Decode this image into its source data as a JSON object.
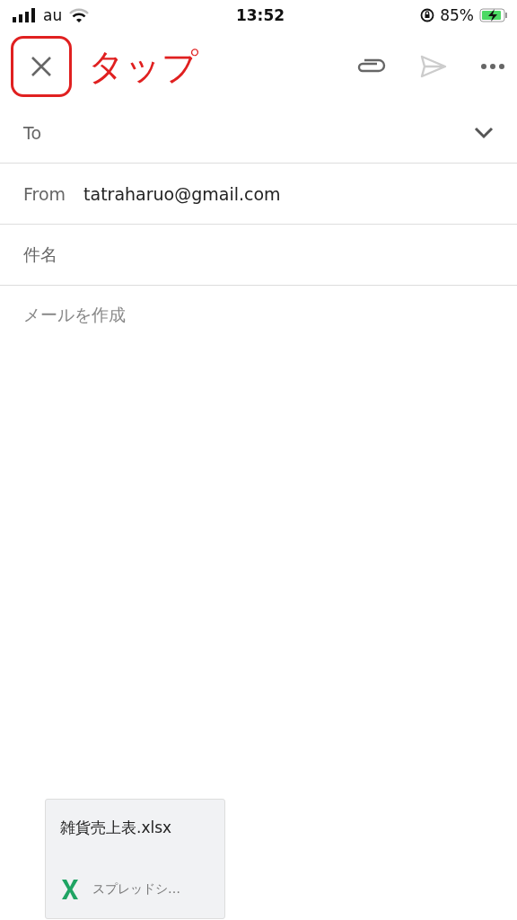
{
  "status_bar": {
    "carrier": "au",
    "time": "13:52",
    "battery_percent": "85%",
    "charging": true
  },
  "annotation": {
    "text": "タップ"
  },
  "fields": [
    {
      "kind": "to",
      "label": "To"
    },
    {
      "kind": "from",
      "label": "From",
      "value": "tatraharuo@gmail.com"
    },
    {
      "kind": "subject",
      "placeholder": "件名"
    }
  ],
  "body": {
    "placeholder": "メールを作成"
  },
  "attachment": {
    "filename": "雑貨売上表.xlsx",
    "type_label": "スプレッドシ…"
  }
}
